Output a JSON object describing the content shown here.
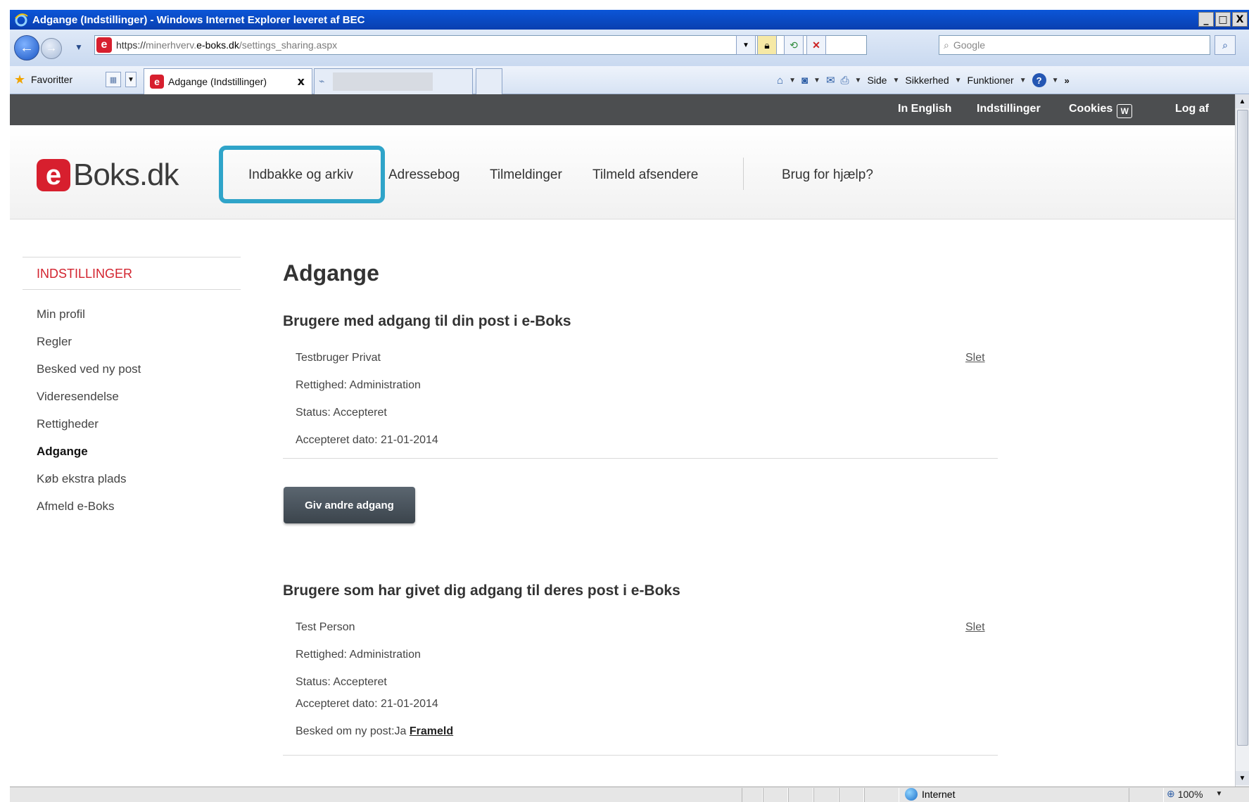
{
  "window": {
    "title": "Adgange (Indstillinger) - Windows Internet Explorer leveret af BEC",
    "min": "_",
    "max": "□",
    "close": "X"
  },
  "address": {
    "url_prefix": "https://",
    "url_sub": "minerhverv.",
    "url_domain": "e-boks.dk",
    "url_path": "/settings_sharing.aspx",
    "search_placeholder": "Google",
    "back_glyph": "←",
    "forward_glyph": "→",
    "refresh_glyph": "⟲",
    "stop_glyph": "✕"
  },
  "favbar": {
    "favorites_label": "Favoritter",
    "active_tab_label": "Adgange (Indstillinger)",
    "tab_close": "x",
    "commands": [
      {
        "label": "Side",
        "icon": "page-icon"
      },
      {
        "label": "Sikkerhed",
        "icon": "safety-icon"
      },
      {
        "label": "Funktioner",
        "icon": "tools-icon"
      }
    ],
    "help": "?"
  },
  "topbar": {
    "english": "In English",
    "settings": "Indstillinger",
    "cookies": "Cookies",
    "cookies_icon": "W",
    "logout": "Log af"
  },
  "logo": {
    "mark": "e",
    "text": "Boks.dk"
  },
  "menu": {
    "items": [
      "Indbakke og arkiv",
      "Adressebog",
      "Tilmeldinger",
      "Tilmeld afsendere"
    ],
    "help": "Brug for hjælp?"
  },
  "sidebar": {
    "title": "INDSTILLINGER",
    "items": [
      {
        "label": "Min profil",
        "active": false
      },
      {
        "label": "Regler",
        "active": false
      },
      {
        "label": "Besked ved ny post",
        "active": false
      },
      {
        "label": "Videresendelse",
        "active": false
      },
      {
        "label": "Rettigheder",
        "active": false
      },
      {
        "label": "Adgange",
        "active": true
      },
      {
        "label": "Køb ekstra plads",
        "active": false
      },
      {
        "label": "Afmeld e-Boks",
        "active": false
      }
    ]
  },
  "main": {
    "title": "Adgange",
    "section1": {
      "heading": "Brugere med adgang til din post i e-Boks",
      "name": "Testbruger Privat",
      "delete": "Slet",
      "right": "Rettighed: Administration",
      "status": "Status: Accepteret",
      "accepted": "Accepteret dato: 21-01-2014"
    },
    "give_button": "Giv andre adgang",
    "section2": {
      "heading": "Brugere som har givet dig adgang til deres post i e-Boks",
      "name": "Test Person",
      "delete": "Slet",
      "right": "Rettighed: Administration",
      "status": "Status: Accepteret",
      "accepted": "Accepteret dato: 21-01-2014",
      "notify_prefix": "Besked om ny post:Ja",
      "unsubscribe": "Frameld"
    }
  },
  "statusbar": {
    "zone": "Internet",
    "zoom": "100%"
  }
}
